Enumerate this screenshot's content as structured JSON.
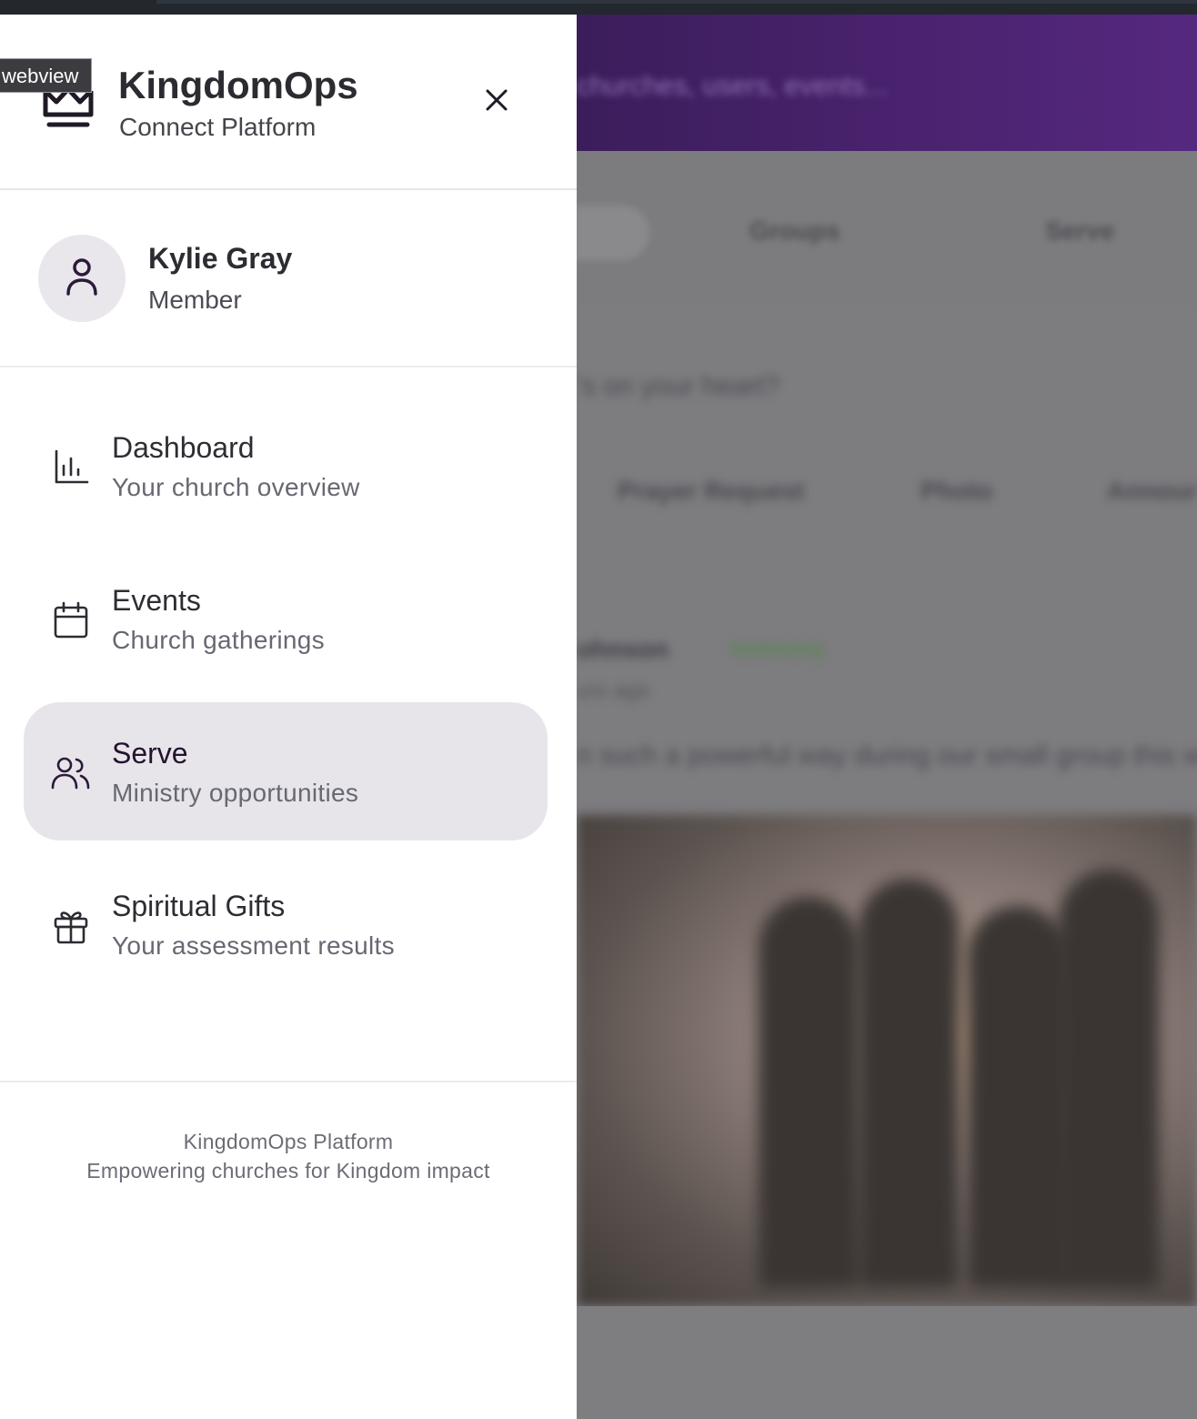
{
  "tooltip": "webview",
  "brand": {
    "title": "KingdomOps",
    "subtitle": "Connect Platform"
  },
  "profile": {
    "name": "Kylie Gray",
    "role": "Member"
  },
  "nav": [
    {
      "title": "Dashboard",
      "subtitle": "Your church overview",
      "icon": "bar-chart-icon",
      "active": false
    },
    {
      "title": "Events",
      "subtitle": "Church gatherings",
      "icon": "calendar-icon",
      "active": false
    },
    {
      "title": "Serve",
      "subtitle": "Ministry opportunities",
      "icon": "users-icon",
      "active": true
    },
    {
      "title": "Spiritual Gifts",
      "subtitle": "Your assessment results",
      "icon": "gift-icon",
      "active": false
    }
  ],
  "footer": {
    "line1": "KingdomOps Platform",
    "line2": "Empowering churches for Kingdom impact"
  },
  "background": {
    "header_text": "churches, users, events...",
    "tabs": [
      "Groups",
      "Serve"
    ],
    "composer_prompt": "'s on your heart?",
    "actions": [
      "Prayer Request",
      "Photo",
      "Annour"
    ],
    "post_author": "ohnson",
    "post_badge": "testimony",
    "post_time": "urs ago",
    "post_text": "n such a powerful way during our small group this w"
  },
  "colors": {
    "accent_active_bg": "#e7e5ea",
    "brand_purple": "#4a2470",
    "icon_color": "#2c1a3a"
  }
}
